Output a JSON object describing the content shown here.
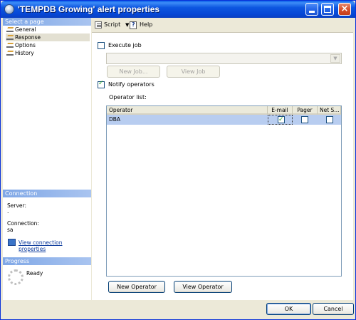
{
  "window": {
    "title": "'TEMPDB Growing' alert properties",
    "controls": {
      "minimize": "minimize",
      "maximize": "maximize",
      "close": "×"
    }
  },
  "left_panel": {
    "select_page_header": "Select a page",
    "pages": [
      {
        "label": "General",
        "selected": false
      },
      {
        "label": "Response",
        "selected": true
      },
      {
        "label": "Options",
        "selected": false
      },
      {
        "label": "History",
        "selected": false
      }
    ],
    "connection_header": "Connection",
    "server_label": "Server:",
    "server_value": ".",
    "connection_label": "Connection:",
    "connection_value": "sa",
    "view_connection_link": "View connection properties",
    "progress_header": "Progress",
    "progress_status": "Ready"
  },
  "toolbar": {
    "script_label": "Script",
    "script_caret": "▼",
    "help_label": "Help"
  },
  "response": {
    "execute_job_label": "Execute job",
    "execute_job_checked": false,
    "job_combo_value": "",
    "combo_arrow": "▼",
    "new_job_button": "New Job...",
    "view_job_button": "View Job",
    "notify_operators_label": "Notify operators",
    "notify_operators_checked": true,
    "operator_list_label": "Operator list:",
    "columns": [
      "Operator",
      "E-mail",
      "Pager",
      "Net S..."
    ],
    "operators": [
      {
        "name": "DBA",
        "email": true,
        "pager": false,
        "net_send": false
      }
    ],
    "new_operator_button": "New Operator",
    "view_operator_button": "View Operator"
  },
  "footer": {
    "ok_button": "OK",
    "cancel_button": "Cancel"
  },
  "colors": {
    "titlebar": "#0647d5",
    "section_header": "#7fa7e6",
    "window_background": "#ece9d8",
    "selected_row": "#b8cdf0",
    "link": "#0b3a9c"
  },
  "icons": [
    "app-icon",
    "page-icon",
    "script-icon",
    "help-icon",
    "connection-icon",
    "progress-spinner-icon"
  ]
}
